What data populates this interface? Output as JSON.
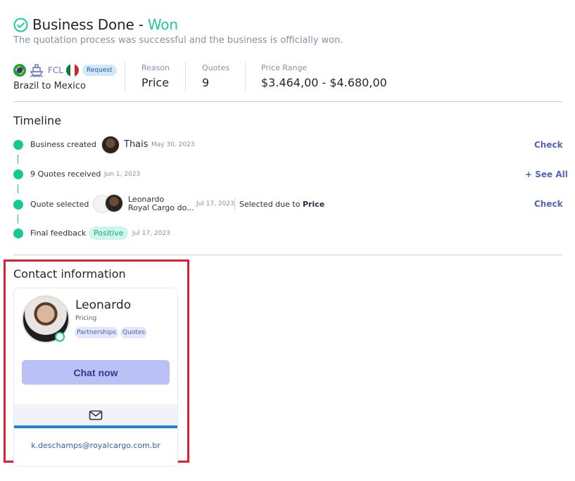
{
  "header": {
    "title_main": "Business Done - ",
    "title_status": "Won",
    "subtitle": "The quotation process was successful and the business is officially won."
  },
  "route": {
    "mode": "FCL",
    "badge": "Request",
    "text": "Brazil to Mexico"
  },
  "stats": [
    {
      "label": "Reason",
      "value": "Price"
    },
    {
      "label": "Quotes",
      "value": "9"
    },
    {
      "label": "Price Range",
      "value": "$3.464,00 - $4.680,00"
    }
  ],
  "timeline": {
    "title": "Timeline",
    "items": [
      {
        "label": "Business created",
        "person": "Thais",
        "date": "May 30, 2023",
        "action": "Check"
      },
      {
        "label": "9 Quotes received",
        "date": "Jun 1, 2023",
        "action": "+ See All"
      },
      {
        "label": "Quote selected",
        "person": "Leonardo",
        "company": "Royal Cargo do...",
        "date": "Jul 17, 2023",
        "note": "Selected due to ",
        "note_bold": "Price",
        "action": "Check"
      },
      {
        "label": "Final feedback",
        "badge": "Positive",
        "date": "Jul 17, 2023"
      }
    ]
  },
  "contact": {
    "title": "Contact information",
    "name": "Leonardo",
    "role": "Pricing",
    "tags": [
      "Partnerships",
      "Quotes"
    ],
    "chat_label": "Chat now",
    "email": "k.deschamps@royalcargo.com.br"
  },
  "colors": {
    "accent_green": "#16c993",
    "won_green": "#1fc9a0",
    "link_blue": "#5563b8",
    "highlight_red": "#e02030"
  }
}
